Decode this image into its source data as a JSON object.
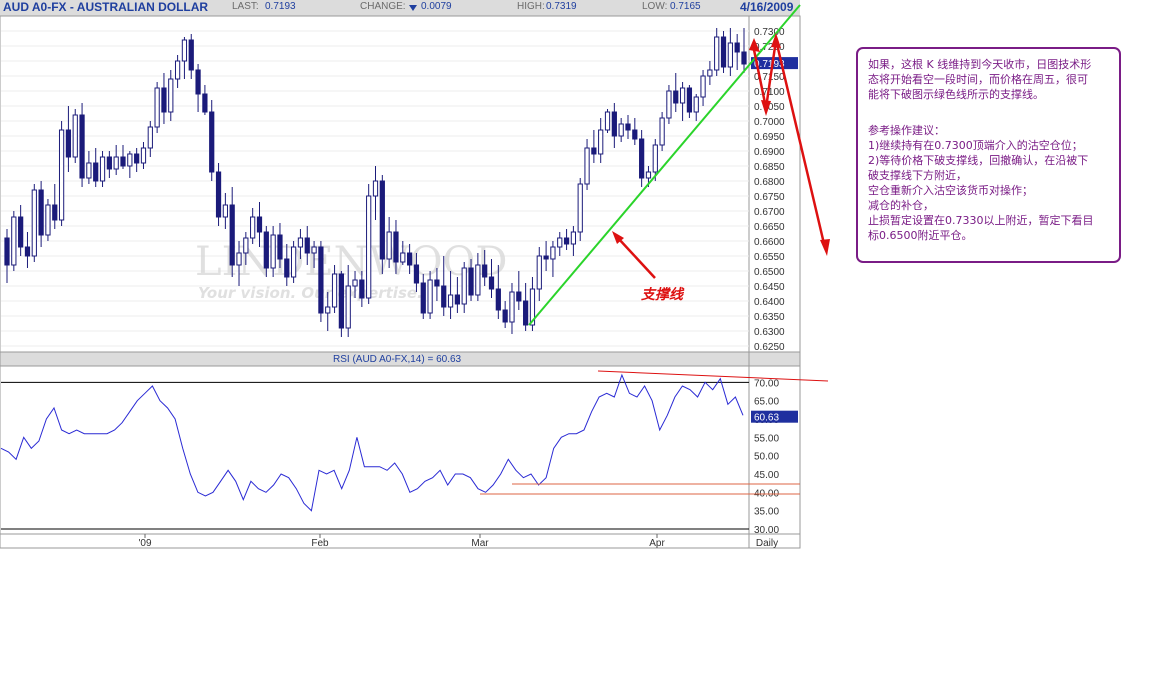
{
  "header": {
    "title": "AUD A0-FX - AUSTRALIAN DOLLAR",
    "last_label": "LAST:",
    "last_value": "0.7193",
    "change_label": "CHANGE:",
    "change_value": "0.0079",
    "high_label": "HIGH:",
    "high_value": "0.7319",
    "low_label": "LOW:",
    "low_value": "0.7165",
    "date": "4/16/2009"
  },
  "watermark": {
    "logo": "LINDENWOOD",
    "tagline": "Your vision. Our expertise."
  },
  "annotation": {
    "support_label": "支撑线",
    "note_lines": [
      "如果，这根 K 线维持到今天收市，日图技术形",
      "态将开始看空一段时间，而价格在周五，很可",
      "能将下破图示绿色线所示的支撑线。"
    ],
    "advice_lines": [
      "参考操作建议：",
      "1)继续持有在0.7300顶端介入的沽空仓位；",
      "2)等待价格下破支撑线，回撤确认，在沿被下",
      "破支撑线下方附近，",
      "空仓重新介入沽空该货币对操作；",
      "减仓的补仓，",
      "止损暂定设置在0.7330以上附近，暂定下看目",
      "标0.6500附近平仓。"
    ]
  },
  "rsi_label": "RSI (AUD A0-FX,14) = 60.63",
  "colors": {
    "candle": "#1b1b7a",
    "support": "#2bd42b",
    "arrow": "#dd1111",
    "rsi": "#2a2ad4",
    "rsi_level": "#dd6644",
    "note_text": "#7a1c86"
  },
  "chart_data": [
    {
      "type": "candlestick",
      "ylim": [
        0.625,
        0.73
      ],
      "yticks": [
        "0.7300",
        "0.7250",
        "0.7200",
        "0.7150",
        "0.7100",
        "0.7050",
        "0.7000",
        "0.6950",
        "0.6900",
        "0.6850",
        "0.6800",
        "0.6750",
        "0.6700",
        "0.6650",
        "0.6600",
        "0.6550",
        "0.6500",
        "0.6450",
        "0.6400",
        "0.6350",
        "0.6300",
        "0.6250"
      ],
      "last_value_label": "0.7193",
      "xtick_labels": [
        "'09",
        "Feb",
        "Mar",
        "Apr",
        "Daily"
      ],
      "ohlc": [
        [
          0.661,
          0.664,
          0.646,
          0.652
        ],
        [
          0.652,
          0.67,
          0.65,
          0.668
        ],
        [
          0.668,
          0.672,
          0.655,
          0.658
        ],
        [
          0.658,
          0.663,
          0.651,
          0.655
        ],
        [
          0.655,
          0.679,
          0.653,
          0.677
        ],
        [
          0.677,
          0.68,
          0.658,
          0.662
        ],
        [
          0.662,
          0.674,
          0.66,
          0.672
        ],
        [
          0.672,
          0.679,
          0.664,
          0.667
        ],
        [
          0.667,
          0.7,
          0.665,
          0.697
        ],
        [
          0.697,
          0.705,
          0.683,
          0.688
        ],
        [
          0.688,
          0.704,
          0.686,
          0.702
        ],
        [
          0.702,
          0.706,
          0.678,
          0.681
        ],
        [
          0.681,
          0.69,
          0.679,
          0.686
        ],
        [
          0.686,
          0.691,
          0.678,
          0.68
        ],
        [
          0.68,
          0.69,
          0.678,
          0.688
        ],
        [
          0.688,
          0.69,
          0.681,
          0.684
        ],
        [
          0.684,
          0.692,
          0.682,
          0.688
        ],
        [
          0.688,
          0.692,
          0.684,
          0.685
        ],
        [
          0.685,
          0.69,
          0.681,
          0.689
        ],
        [
          0.689,
          0.691,
          0.683,
          0.686
        ],
        [
          0.686,
          0.693,
          0.684,
          0.691
        ],
        [
          0.691,
          0.7,
          0.688,
          0.698
        ],
        [
          0.698,
          0.713,
          0.696,
          0.711
        ],
        [
          0.711,
          0.716,
          0.699,
          0.703
        ],
        [
          0.703,
          0.717,
          0.7,
          0.714
        ],
        [
          0.714,
          0.722,
          0.711,
          0.72
        ],
        [
          0.72,
          0.728,
          0.714,
          0.727
        ],
        [
          0.727,
          0.729,
          0.714,
          0.717
        ],
        [
          0.717,
          0.719,
          0.703,
          0.709
        ],
        [
          0.709,
          0.712,
          0.702,
          0.703
        ],
        [
          0.703,
          0.707,
          0.68,
          0.683
        ],
        [
          0.683,
          0.686,
          0.665,
          0.668
        ],
        [
          0.668,
          0.676,
          0.664,
          0.672
        ],
        [
          0.672,
          0.678,
          0.648,
          0.652
        ],
        [
          0.652,
          0.66,
          0.645,
          0.656
        ],
        [
          0.656,
          0.663,
          0.652,
          0.661
        ],
        [
          0.661,
          0.671,
          0.659,
          0.668
        ],
        [
          0.668,
          0.673,
          0.658,
          0.663
        ],
        [
          0.663,
          0.665,
          0.648,
          0.651
        ],
        [
          0.651,
          0.665,
          0.648,
          0.662
        ],
        [
          0.662,
          0.666,
          0.651,
          0.654
        ],
        [
          0.654,
          0.659,
          0.645,
          0.648
        ],
        [
          0.648,
          0.66,
          0.646,
          0.658
        ],
        [
          0.658,
          0.664,
          0.654,
          0.661
        ],
        [
          0.661,
          0.665,
          0.652,
          0.656
        ],
        [
          0.656,
          0.66,
          0.651,
          0.658
        ],
        [
          0.658,
          0.66,
          0.633,
          0.636
        ],
        [
          0.636,
          0.643,
          0.63,
          0.638
        ],
        [
          0.638,
          0.652,
          0.636,
          0.649
        ],
        [
          0.649,
          0.65,
          0.628,
          0.631
        ],
        [
          0.631,
          0.652,
          0.628,
          0.645
        ],
        [
          0.645,
          0.65,
          0.641,
          0.647
        ],
        [
          0.647,
          0.65,
          0.638,
          0.641
        ],
        [
          0.641,
          0.679,
          0.639,
          0.675
        ],
        [
          0.675,
          0.685,
          0.667,
          0.68
        ],
        [
          0.68,
          0.682,
          0.649,
          0.654
        ],
        [
          0.654,
          0.668,
          0.651,
          0.663
        ],
        [
          0.663,
          0.667,
          0.649,
          0.653
        ],
        [
          0.653,
          0.66,
          0.652,
          0.656
        ],
        [
          0.656,
          0.659,
          0.649,
          0.652
        ],
        [
          0.652,
          0.656,
          0.643,
          0.646
        ],
        [
          0.646,
          0.649,
          0.634,
          0.636
        ],
        [
          0.636,
          0.65,
          0.634,
          0.647
        ],
        [
          0.647,
          0.651,
          0.64,
          0.645
        ],
        [
          0.645,
          0.655,
          0.635,
          0.638
        ],
        [
          0.638,
          0.65,
          0.634,
          0.642
        ],
        [
          0.642,
          0.648,
          0.636,
          0.639
        ],
        [
          0.639,
          0.653,
          0.636,
          0.651
        ],
        [
          0.651,
          0.654,
          0.64,
          0.642
        ],
        [
          0.642,
          0.656,
          0.64,
          0.652
        ],
        [
          0.652,
          0.657,
          0.645,
          0.648
        ],
        [
          0.648,
          0.654,
          0.641,
          0.644
        ],
        [
          0.644,
          0.652,
          0.634,
          0.637
        ],
        [
          0.637,
          0.64,
          0.631,
          0.633
        ],
        [
          0.633,
          0.646,
          0.629,
          0.643
        ],
        [
          0.643,
          0.65,
          0.637,
          0.64
        ],
        [
          0.64,
          0.646,
          0.63,
          0.632
        ],
        [
          0.632,
          0.648,
          0.63,
          0.644
        ],
        [
          0.644,
          0.658,
          0.64,
          0.655
        ],
        [
          0.655,
          0.66,
          0.65,
          0.654
        ],
        [
          0.654,
          0.66,
          0.648,
          0.658
        ],
        [
          0.658,
          0.663,
          0.655,
          0.661
        ],
        [
          0.661,
          0.664,
          0.657,
          0.659
        ],
        [
          0.659,
          0.665,
          0.655,
          0.663
        ],
        [
          0.663,
          0.681,
          0.66,
          0.679
        ],
        [
          0.679,
          0.694,
          0.677,
          0.691
        ],
        [
          0.691,
          0.697,
          0.686,
          0.689
        ],
        [
          0.689,
          0.701,
          0.686,
          0.697
        ],
        [
          0.697,
          0.704,
          0.696,
          0.703
        ],
        [
          0.703,
          0.706,
          0.691,
          0.695
        ],
        [
          0.695,
          0.701,
          0.693,
          0.699
        ],
        [
          0.699,
          0.702,
          0.694,
          0.697
        ],
        [
          0.697,
          0.701,
          0.692,
          0.694
        ],
        [
          0.694,
          0.697,
          0.678,
          0.681
        ],
        [
          0.681,
          0.685,
          0.678,
          0.683
        ],
        [
          0.683,
          0.694,
          0.68,
          0.692
        ],
        [
          0.692,
          0.703,
          0.69,
          0.701
        ],
        [
          0.701,
          0.712,
          0.699,
          0.71
        ],
        [
          0.71,
          0.716,
          0.703,
          0.706
        ],
        [
          0.706,
          0.713,
          0.7,
          0.711
        ],
        [
          0.711,
          0.712,
          0.701,
          0.703
        ],
        [
          0.703,
          0.709,
          0.7,
          0.708
        ],
        [
          0.708,
          0.717,
          0.705,
          0.715
        ],
        [
          0.715,
          0.72,
          0.712,
          0.717
        ],
        [
          0.717,
          0.731,
          0.715,
          0.728
        ],
        [
          0.728,
          0.73,
          0.716,
          0.718
        ],
        [
          0.718,
          0.731,
          0.715,
          0.726
        ],
        [
          0.726,
          0.729,
          0.717,
          0.723
        ],
        [
          0.723,
          0.731,
          0.716,
          0.719
        ]
      ]
    },
    {
      "type": "line",
      "name": "RSI (AUD A0-FX,14)",
      "ylim": [
        30,
        72
      ],
      "yticks": [
        "70.00",
        "65.00",
        "60.00",
        "55.00",
        "50.00",
        "45.00",
        "40.00",
        "35.00",
        "30.00"
      ],
      "levels": [
        70,
        30
      ],
      "last_value_label": "60.63",
      "values": [
        52,
        51,
        49,
        55,
        52,
        54,
        60,
        63,
        57,
        56,
        57,
        56,
        56,
        56,
        56,
        57,
        59,
        62,
        65,
        67,
        69,
        65,
        63,
        60,
        52,
        45,
        40,
        39,
        40,
        43,
        46,
        43,
        38,
        43,
        41,
        40,
        42,
        45,
        44,
        41,
        37,
        35,
        46,
        45,
        46,
        41,
        46,
        55,
        47,
        47,
        47,
        46,
        48,
        45,
        40,
        41,
        43,
        44,
        46,
        42,
        45,
        45,
        44,
        41,
        40,
        42,
        45,
        49,
        46,
        44,
        45,
        42,
        44,
        52,
        55,
        56,
        56,
        57,
        62,
        66,
        67,
        66,
        72,
        67,
        66,
        69,
        65,
        57,
        61,
        66,
        69,
        68,
        66,
        70,
        68,
        71,
        64,
        66,
        61
      ]
    }
  ]
}
